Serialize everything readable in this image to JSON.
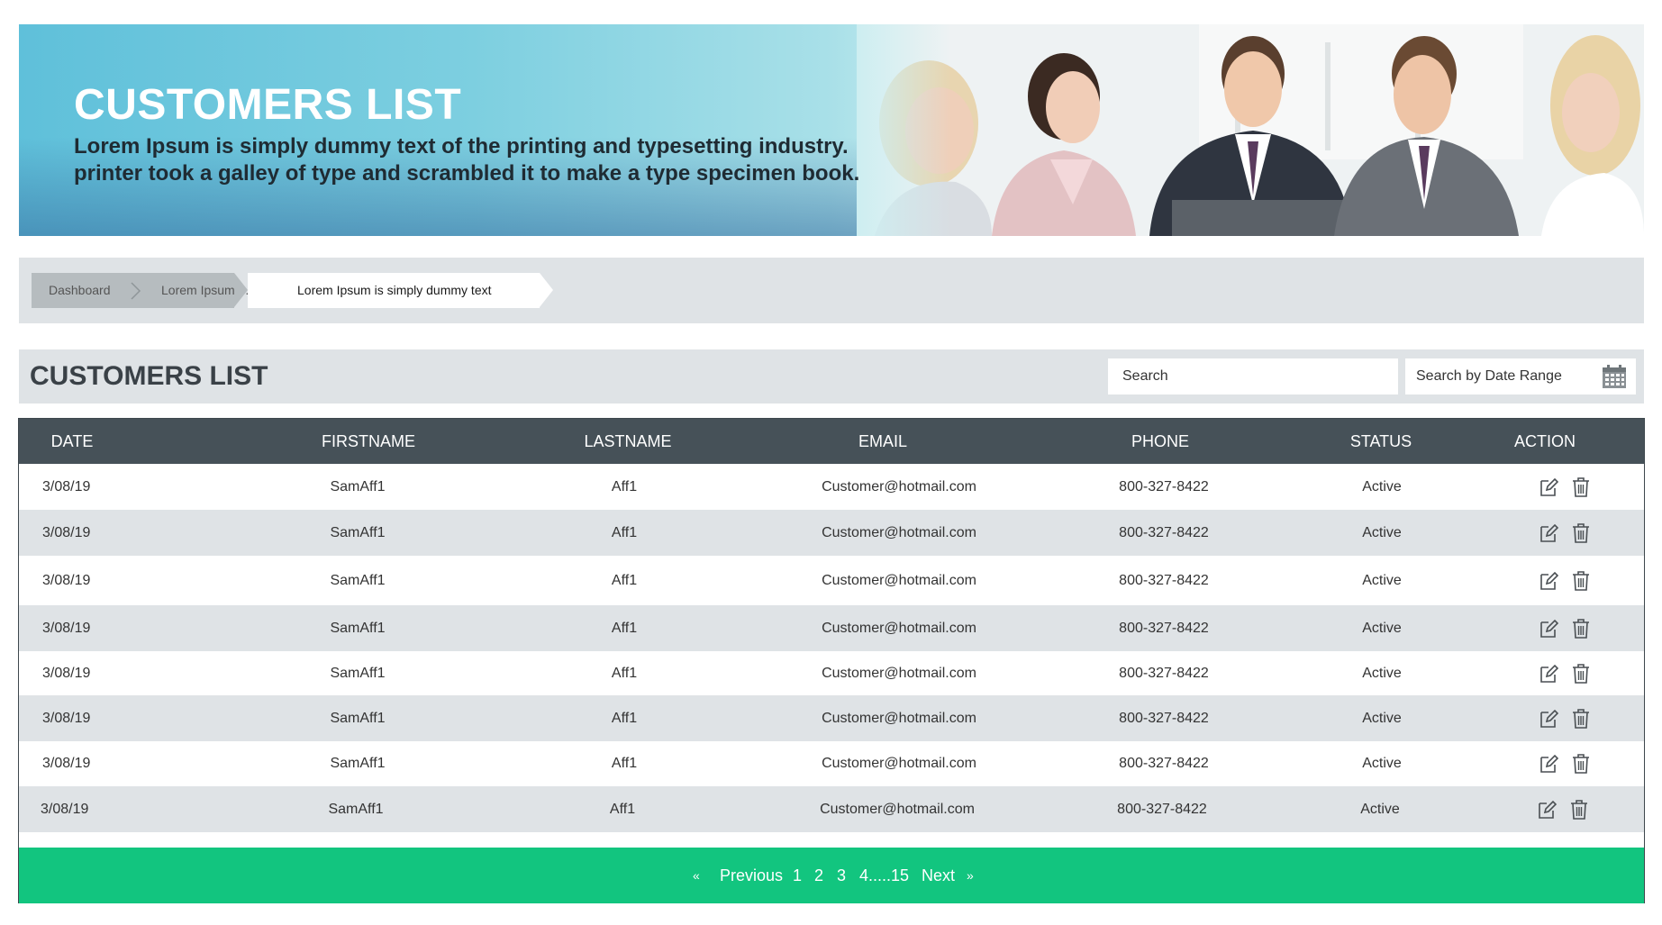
{
  "banner": {
    "title": "CUSTOMERS LIST",
    "subtitle_line1": "Lorem Ipsum is simply dummy text of the printing and typesetting industry.",
    "subtitle_line2": "printer took a galley of type and scrambled it to make a type specimen book."
  },
  "breadcrumb": {
    "items": [
      "Dashboard",
      "Lorem Ipsum.......",
      "Lorem Ipsum is simply dummy text"
    ]
  },
  "list_header": {
    "title": "CUSTOMERS LIST",
    "search_placeholder": "Search",
    "date_range_placeholder": "Search by Date Range"
  },
  "table": {
    "columns": [
      "DATE",
      "FIRSTNAME",
      "LASTNAME",
      "EMAIL",
      "PHONE",
      "STATUS",
      "ACTION"
    ],
    "rows": [
      {
        "date": "3/08/19",
        "firstname": "SamAff1",
        "lastname": "Aff1",
        "email": "Customer@hotmail.com",
        "phone": "800-327-8422",
        "status": "Active"
      },
      {
        "date": "3/08/19",
        "firstname": "SamAff1",
        "lastname": "Aff1",
        "email": "Customer@hotmail.com",
        "phone": "800-327-8422",
        "status": "Active"
      },
      {
        "date": "3/08/19",
        "firstname": "SamAff1",
        "lastname": "Aff1",
        "email": "Customer@hotmail.com",
        "phone": "800-327-8422",
        "status": "Active"
      },
      {
        "date": "3/08/19",
        "firstname": "SamAff1",
        "lastname": "Aff1",
        "email": "Customer@hotmail.com",
        "phone": "800-327-8422",
        "status": "Active"
      },
      {
        "date": "3/08/19",
        "firstname": "SamAff1",
        "lastname": "Aff1",
        "email": "Customer@hotmail.com",
        "phone": "800-327-8422",
        "status": "Active"
      },
      {
        "date": "3/08/19",
        "firstname": "SamAff1",
        "lastname": "Aff1",
        "email": "Customer@hotmail.com",
        "phone": "800-327-8422",
        "status": "Active"
      },
      {
        "date": "3/08/19",
        "firstname": "SamAff1",
        "lastname": "Aff1",
        "email": "Customer@hotmail.com",
        "phone": "800-327-8422",
        "status": "Active"
      },
      {
        "date": "3/08/19",
        "firstname": "SamAff1",
        "lastname": "Aff1",
        "email": "Customer@hotmail.com",
        "phone": "800-327-8422",
        "status": "Active"
      }
    ],
    "action_icons": [
      "edit-icon",
      "trash-icon"
    ]
  },
  "pagination": {
    "prev_arrow": "«",
    "previous": "Previous",
    "pages": [
      "1",
      "2",
      "3",
      "4.....15"
    ],
    "next": "Next",
    "next_arrow": "»"
  },
  "colors": {
    "header_bg": "#465158",
    "panel_bg": "#dfe3e6",
    "pager_bg": "#12c57f",
    "banner_accent": "#5fc0da"
  }
}
